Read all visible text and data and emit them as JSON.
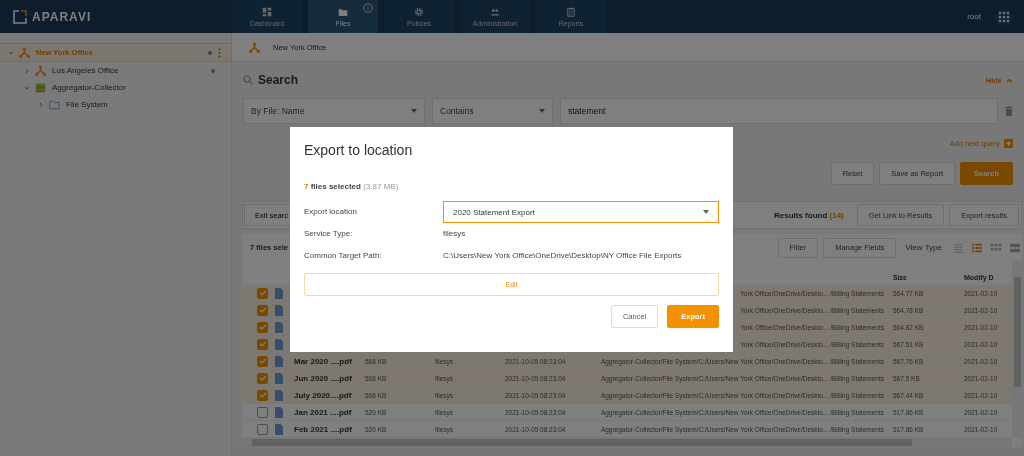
{
  "header": {
    "logo": "APARAVI",
    "nav": [
      {
        "label": "Dashboard",
        "kind": "dashboard",
        "selected": false,
        "info": false
      },
      {
        "label": "Files",
        "kind": "folder",
        "selected": true,
        "info": true
      },
      {
        "label": "Policies",
        "kind": "gear",
        "selected": false,
        "info": false
      },
      {
        "label": "Administration",
        "kind": "people",
        "selected": false,
        "info": false
      },
      {
        "label": "Reports",
        "kind": "clipboard",
        "selected": false,
        "info": false
      }
    ],
    "user": "root"
  },
  "sidebar": {
    "tree": [
      {
        "label": "New York Office",
        "kind": "node",
        "selected": true,
        "expanded": true,
        "status_dot": true,
        "children": [
          {
            "label": "Los Angeles Office",
            "kind": "node",
            "selected": false,
            "expanded": false,
            "status_dot": true
          },
          {
            "label": "Aggregator-Collector",
            "kind": "collector",
            "selected": false,
            "expanded": true,
            "status_dot": false,
            "children": [
              {
                "label": "File System",
                "kind": "folder",
                "selected": false,
                "expanded": false,
                "status_dot": false
              }
            ]
          }
        ]
      }
    ]
  },
  "breadcrumb": {
    "label": "New York Office"
  },
  "search": {
    "title": "Search",
    "hide_label": "Hide",
    "queries": [
      {
        "field": "By File: Name",
        "operator": "Contains",
        "value": "statement"
      }
    ],
    "add_query": "Add next query",
    "buttons": [
      {
        "label": "Reset",
        "kind": "secondary"
      },
      {
        "label": "Save as Report",
        "kind": "secondary"
      },
      {
        "label": "Search",
        "kind": "primary"
      }
    ]
  },
  "results": {
    "exit_label": "Exit searc",
    "found_label": "Results found",
    "found_count": "(14)",
    "buttons": [
      "Get Link to Results",
      "Export results"
    ]
  },
  "table": {
    "selection_label": "7 files sele",
    "buttons": [
      "Filter",
      "Manage Fields"
    ],
    "view_type_label": "View Type",
    "view_types": [
      {
        "kind": "list",
        "selected": false
      },
      {
        "kind": "detail",
        "selected": true
      },
      {
        "kind": "grid",
        "selected": false
      },
      {
        "kind": "tiles",
        "selected": false
      }
    ],
    "columns": {
      "size": "Size",
      "modified": "Modify D"
    },
    "rows": [
      {
        "checked": true,
        "path": "York Office/OneDrive/Deskto... /Billing Statements",
        "size": "564.77 KB",
        "modified": "2021-02-10"
      },
      {
        "checked": true,
        "path": "York Office/OneDrive/Deskto... /Billing Statements",
        "size": "564.78 KB",
        "modified": "2021-02-10"
      },
      {
        "checked": true,
        "path": "York Office/OneDrive/Deskto... /Billing Statements",
        "size": "564.82 KB",
        "modified": "2021-02-10"
      },
      {
        "checked": true,
        "path": "York Office/OneDrive/Deskto... /Billing Statements",
        "size": "567.51 KB",
        "modified": "2021-02-10"
      },
      {
        "checked": true,
        "name": "Mar 2020 ....pdf",
        "column_3": "568 KB",
        "column_4": "filesys",
        "column_5": "2021-10-05 08:23:04",
        "path": "Aggregator-Collector/File System/C:/Users/New York Office/OneDrive/Deskto... /Billing Statements",
        "size": "567.76 KB",
        "modified": "2021-02-10"
      },
      {
        "checked": true,
        "name": "Jun 2020 ....pdf",
        "column_3": "568 KB",
        "column_4": "filesys",
        "column_5": "2021-10-05 08:23:04",
        "path": "Aggregator-Collector/File System/C:/Users/New York Office/OneDrive/Deskto... /Billing Statements",
        "size": "567.5 KB",
        "modified": "2021-02-10"
      },
      {
        "checked": true,
        "name": "July 2020....pdf",
        "column_3": "568 KB",
        "column_4": "filesys",
        "column_5": "2021-10-05 08:23:04",
        "path": "Aggregator-Collector/File System/C:/Users/New York Office/OneDrive/Deskto... /Billing Statements",
        "size": "567.44 KB",
        "modified": "2021-02-10"
      },
      {
        "checked": false,
        "name": "Jan 2021 ....pdf",
        "column_3": "520 KB",
        "column_4": "filesys",
        "column_5": "2021-10-05 08:23:04",
        "path": "Aggregator-Collector/File System/C:/Users/New York Office/OneDrive/Deskto... /Billing Statements",
        "size": "517.86 KB",
        "modified": "2021-02-10"
      },
      {
        "checked": false,
        "name": "Feb 2021 ....pdf",
        "column_3": "520 KB",
        "column_4": "filesys",
        "column_5": "2021-10-05 08:23:04",
        "path": "Aggregator-Collector/File System/C:/Users/New York Office/OneDrive/Deskto... /Billing Statements",
        "size": "517.86 KB",
        "modified": "2021-02-10"
      }
    ]
  },
  "modal": {
    "title": "Export to location",
    "selection": {
      "count": "7",
      "label": "files selected",
      "size": "(3.87 MB)"
    },
    "fields": [
      {
        "label": "Export location",
        "kind": "select",
        "value": "2020 Statement Export"
      },
      {
        "label": "Service Type:",
        "kind": "text",
        "value": "filesys"
      },
      {
        "label": "Common Target Path:",
        "kind": "text",
        "value": "C:\\Users\\New York Office\\OneDrive\\Desktop\\NY Office File Exports"
      }
    ],
    "edit_label": "Edit",
    "buttons": [
      {
        "label": "Cancel",
        "kind": "secondary"
      },
      {
        "label": "Export",
        "kind": "primary"
      }
    ]
  }
}
